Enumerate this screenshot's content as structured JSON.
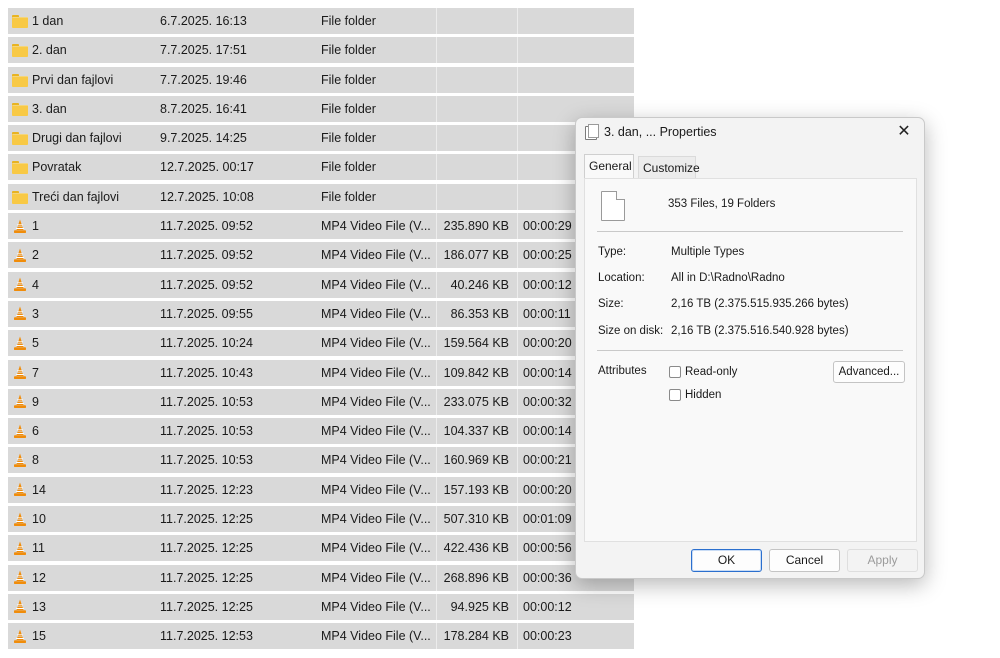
{
  "files": [
    {
      "icon": "folder-icon",
      "name": "1 dan",
      "date": "6.7.2025. 16:13",
      "type": "File folder",
      "size": "",
      "length": ""
    },
    {
      "icon": "folder-icon",
      "name": "2. dan",
      "date": "7.7.2025. 17:51",
      "type": "File folder",
      "size": "",
      "length": ""
    },
    {
      "icon": "folder-icon",
      "name": "Prvi dan fajlovi",
      "date": "7.7.2025. 19:46",
      "type": "File folder",
      "size": "",
      "length": ""
    },
    {
      "icon": "folder-icon",
      "name": "3. dan",
      "date": "8.7.2025. 16:41",
      "type": "File folder",
      "size": "",
      "length": ""
    },
    {
      "icon": "folder-icon",
      "name": "Drugi dan fajlovi",
      "date": "9.7.2025. 14:25",
      "type": "File folder",
      "size": "",
      "length": ""
    },
    {
      "icon": "folder-icon",
      "name": "Povratak",
      "date": "12.7.2025. 00:17",
      "type": "File folder",
      "size": "",
      "length": ""
    },
    {
      "icon": "folder-icon",
      "name": "Treći dan fajlovi",
      "date": "12.7.2025. 10:08",
      "type": "File folder",
      "size": "",
      "length": ""
    },
    {
      "icon": "vlc-cone-icon",
      "name": "1",
      "date": "11.7.2025. 09:52",
      "type": "MP4 Video File (V...",
      "size": "235.890 KB",
      "length": "00:00:29"
    },
    {
      "icon": "vlc-cone-icon",
      "name": "2",
      "date": "11.7.2025. 09:52",
      "type": "MP4 Video File (V...",
      "size": "186.077 KB",
      "length": "00:00:25"
    },
    {
      "icon": "vlc-cone-icon",
      "name": "4",
      "date": "11.7.2025. 09:52",
      "type": "MP4 Video File (V...",
      "size": "40.246 KB",
      "length": "00:00:12"
    },
    {
      "icon": "vlc-cone-icon",
      "name": "3",
      "date": "11.7.2025. 09:55",
      "type": "MP4 Video File (V...",
      "size": "86.353 KB",
      "length": "00:00:11"
    },
    {
      "icon": "vlc-cone-icon",
      "name": "5",
      "date": "11.7.2025. 10:24",
      "type": "MP4 Video File (V...",
      "size": "159.564 KB",
      "length": "00:00:20"
    },
    {
      "icon": "vlc-cone-icon",
      "name": "7",
      "date": "11.7.2025. 10:43",
      "type": "MP4 Video File (V...",
      "size": "109.842 KB",
      "length": "00:00:14"
    },
    {
      "icon": "vlc-cone-icon",
      "name": "9",
      "date": "11.7.2025. 10:53",
      "type": "MP4 Video File (V...",
      "size": "233.075 KB",
      "length": "00:00:32"
    },
    {
      "icon": "vlc-cone-icon",
      "name": "6",
      "date": "11.7.2025. 10:53",
      "type": "MP4 Video File (V...",
      "size": "104.337 KB",
      "length": "00:00:14"
    },
    {
      "icon": "vlc-cone-icon",
      "name": "8",
      "date": "11.7.2025. 10:53",
      "type": "MP4 Video File (V...",
      "size": "160.969 KB",
      "length": "00:00:21"
    },
    {
      "icon": "vlc-cone-icon",
      "name": "14",
      "date": "11.7.2025. 12:23",
      "type": "MP4 Video File (V...",
      "size": "157.193 KB",
      "length": "00:00:20"
    },
    {
      "icon": "vlc-cone-icon",
      "name": "10",
      "date": "11.7.2025. 12:25",
      "type": "MP4 Video File (V...",
      "size": "507.310 KB",
      "length": "00:01:09"
    },
    {
      "icon": "vlc-cone-icon",
      "name": "11",
      "date": "11.7.2025. 12:25",
      "type": "MP4 Video File (V...",
      "size": "422.436 KB",
      "length": "00:00:56"
    },
    {
      "icon": "vlc-cone-icon",
      "name": "12",
      "date": "11.7.2025. 12:25",
      "type": "MP4 Video File (V...",
      "size": "268.896 KB",
      "length": "00:00:36"
    },
    {
      "icon": "vlc-cone-icon",
      "name": "13",
      "date": "11.7.2025. 12:25",
      "type": "MP4 Video File (V...",
      "size": "94.925 KB",
      "length": "00:00:12"
    },
    {
      "icon": "vlc-cone-icon",
      "name": "15",
      "date": "11.7.2025. 12:53",
      "type": "MP4 Video File (V...",
      "size": "178.284 KB",
      "length": "00:00:23"
    }
  ],
  "dialog": {
    "title": "3. dan, ... Properties",
    "close_glyph": "✕",
    "tabs": {
      "general": "General",
      "customize": "Customize"
    },
    "summary": "353 Files, 19 Folders",
    "type_label": "Type:",
    "type_value": "Multiple Types",
    "location_label": "Location:",
    "location_value": "All in D:\\Radno\\Radno",
    "size_label": "Size:",
    "size_value": "2,16 TB (2.375.515.935.266 bytes)",
    "size_on_disk_label": "Size on disk:",
    "size_on_disk_value": "2,16 TB (2.375.516.540.928 bytes)",
    "attributes_label": "Attributes",
    "readonly_label": "Read-only",
    "hidden_label": "Hidden",
    "advanced_label": "Advanced...",
    "ok_label": "OK",
    "cancel_label": "Cancel",
    "apply_label": "Apply"
  },
  "colors": {
    "row_background": "#d9d9d9",
    "folder": "#f8c945",
    "vlc_orange": "#f08c0a",
    "ok_border": "#2b6fce"
  }
}
